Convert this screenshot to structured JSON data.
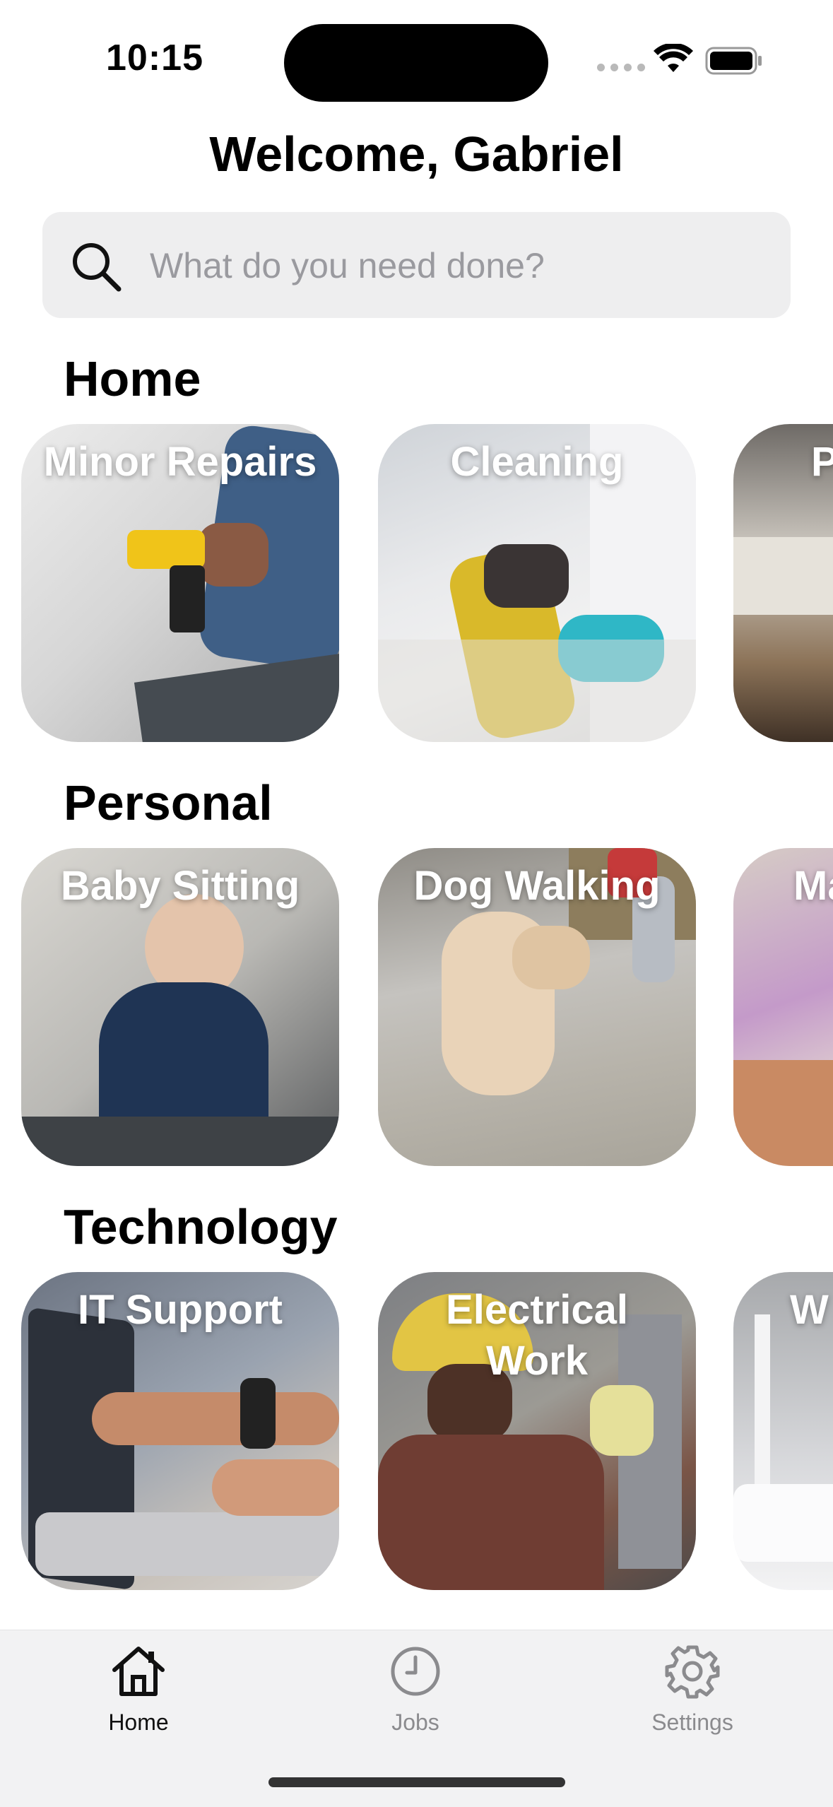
{
  "status_bar": {
    "time": "10:15",
    "icons": [
      "cellular-signal-icon",
      "wifi-icon",
      "battery-icon"
    ]
  },
  "header": {
    "title": "Welcome, Gabriel"
  },
  "search": {
    "placeholder": "What do you need done?",
    "value": "",
    "icon": "search-icon"
  },
  "sections": [
    {
      "title": "Home",
      "cards": [
        {
          "label": "Minor Repairs",
          "image": "person drilling wall"
        },
        {
          "label": "Cleaning",
          "image": "gloved hand with cleaning cloth"
        },
        {
          "label": "P",
          "image": "paint tray"
        }
      ]
    },
    {
      "title": "Personal",
      "cards": [
        {
          "label": "Baby Sitting",
          "image": "baby sitting on floor"
        },
        {
          "label": "Dog Walking",
          "image": "golden retriever on leash"
        },
        {
          "label": "Ma",
          "image": "massage"
        }
      ]
    },
    {
      "title": "Technology",
      "cards": [
        {
          "label": "IT Support",
          "image": "hands pointing at laptop"
        },
        {
          "label": "Electrical Work",
          "image": "electrician at meter"
        },
        {
          "label": "W",
          "image": "wifi router"
        }
      ]
    }
  ],
  "tab_bar": {
    "items": [
      {
        "label": "Home",
        "icon": "house-icon",
        "active": true
      },
      {
        "label": "Jobs",
        "icon": "clock-icon",
        "active": false
      },
      {
        "label": "Settings",
        "icon": "gear-icon",
        "active": false
      }
    ]
  },
  "colors": {
    "background": "#ffffff",
    "search_background": "#eeeeef",
    "tab_bar_background": "#f2f2f3",
    "tab_active": "#111111",
    "tab_inactive": "#8b8b8e"
  }
}
